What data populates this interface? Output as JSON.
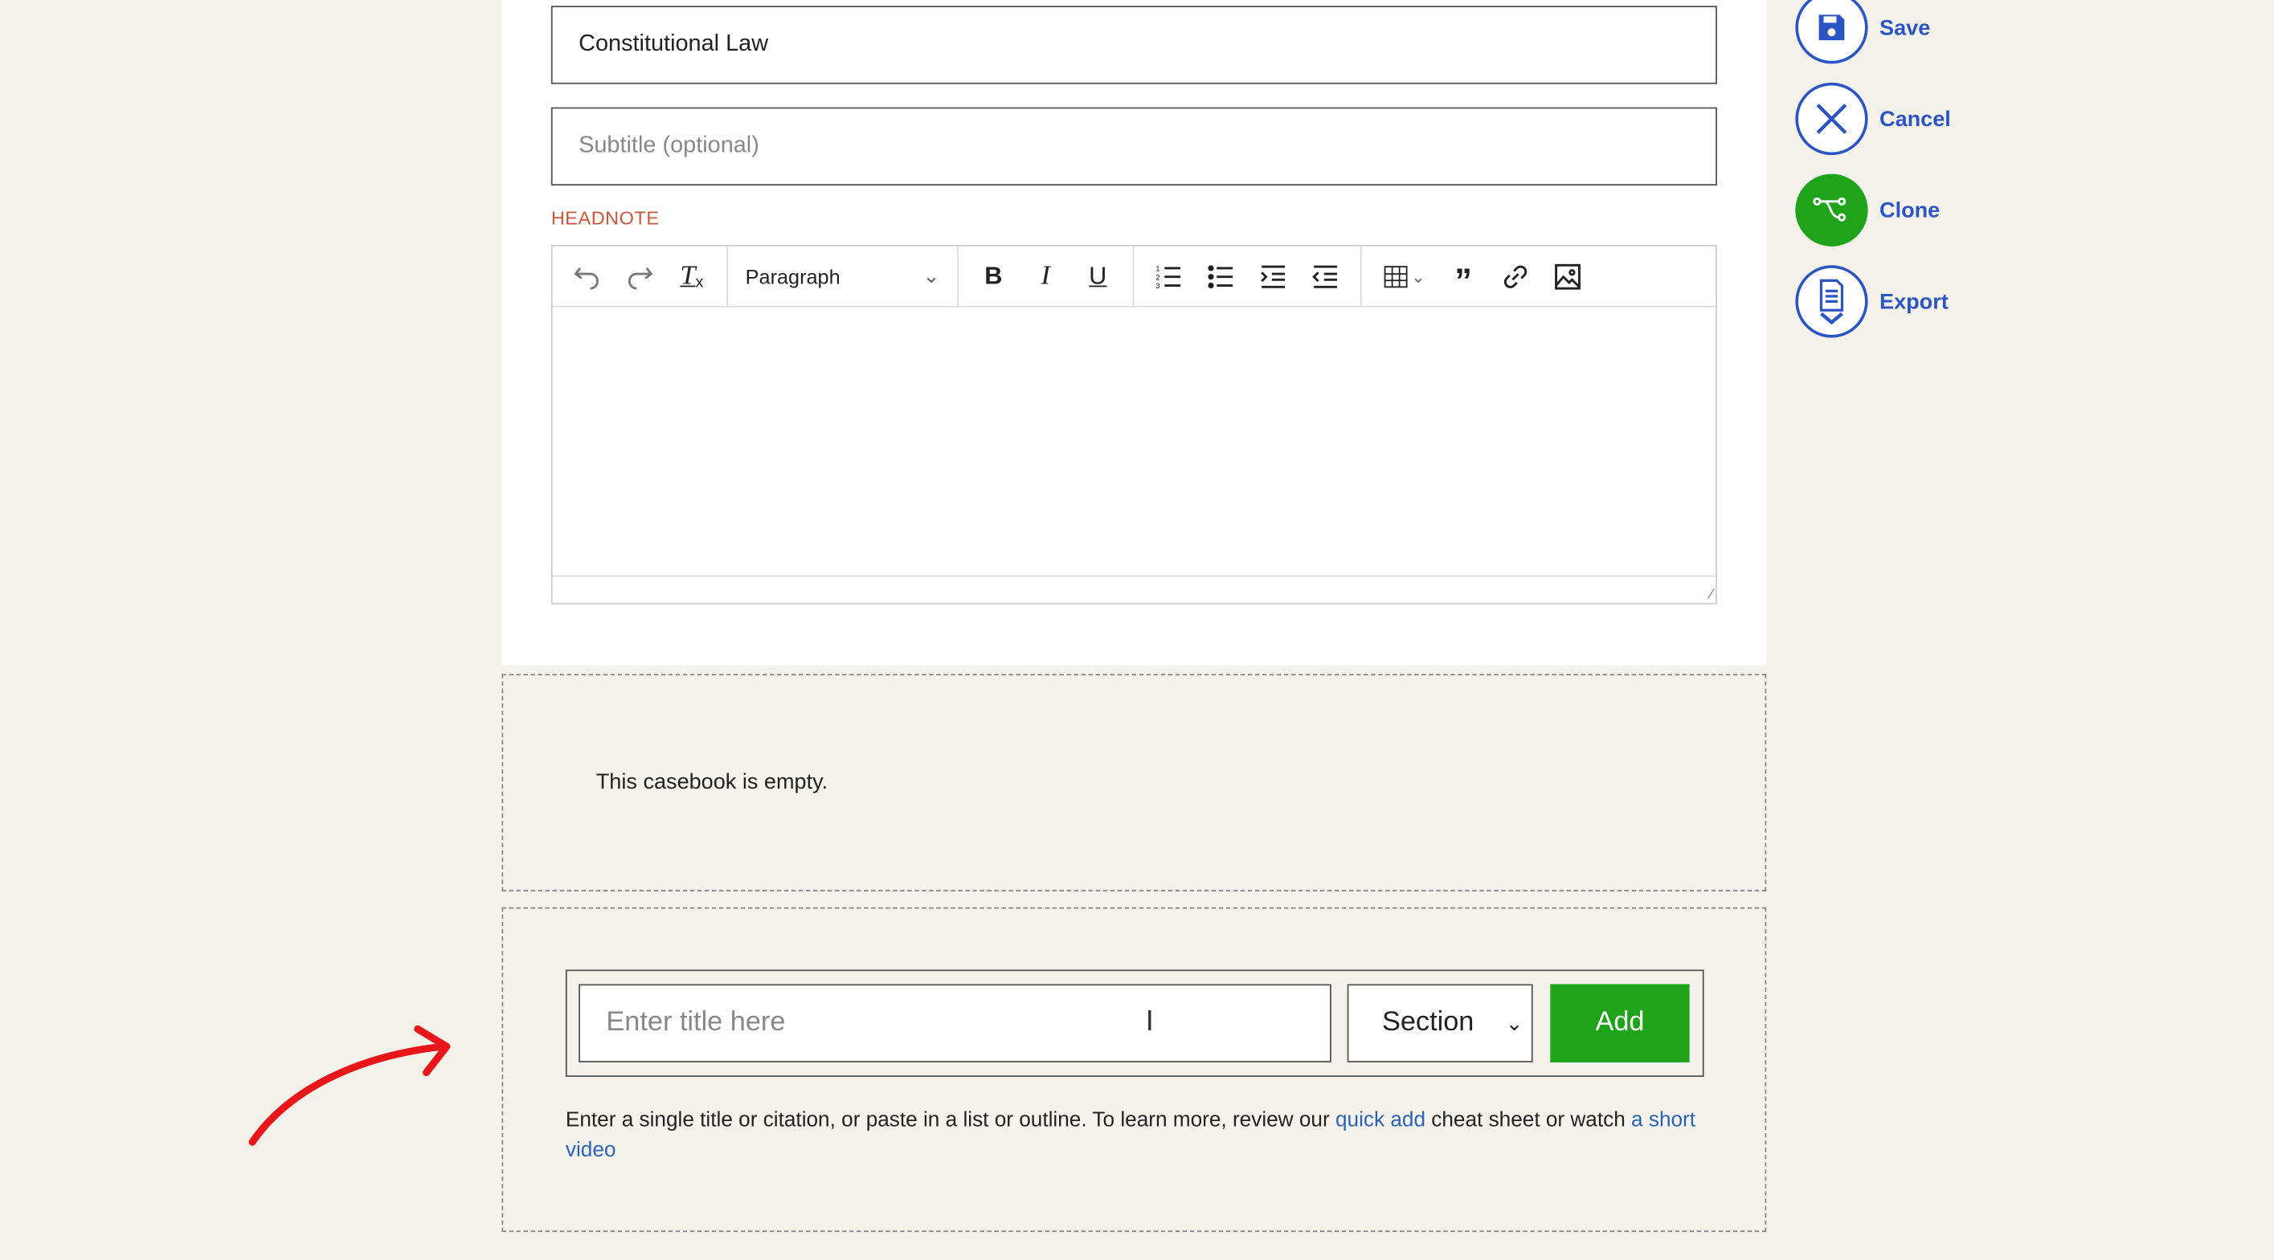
{
  "form": {
    "title_value": "Constitutional Law",
    "subtitle_placeholder": "Subtitle (optional)",
    "headnote_label": "HEADNOTE"
  },
  "editor": {
    "block_format": "Paragraph",
    "tools": [
      "undo-icon",
      "redo-icon",
      "clear-formatting-icon",
      "bold-icon",
      "italic-icon",
      "underline-icon",
      "numbered-list-icon",
      "bullet-list-icon",
      "indent-icon",
      "outdent-icon",
      "table-icon",
      "blockquote-icon",
      "link-icon",
      "image-icon"
    ]
  },
  "empty_message": "This casebook is empty.",
  "quick_add": {
    "title_placeholder": "Enter title here",
    "type_select": "Section",
    "add_label": "Add",
    "help_prefix": "Enter a single title or citation, or paste in a list or outline. To learn more, review our ",
    "help_link1": "quick add",
    "help_mid": " cheat sheet or watch ",
    "help_link2": "a short video"
  },
  "actions": [
    {
      "label": "Save",
      "icon": "save-icon"
    },
    {
      "label": "Cancel",
      "icon": "close-icon"
    },
    {
      "label": "Clone",
      "icon": "clone-icon"
    },
    {
      "label": "Export",
      "icon": "export-icon"
    }
  ],
  "colors": {
    "accent_blue": "#2c55c4",
    "green": "#1fa31a",
    "headnote_red": "#c8553d",
    "annotation_arrow": "#e8161b"
  }
}
